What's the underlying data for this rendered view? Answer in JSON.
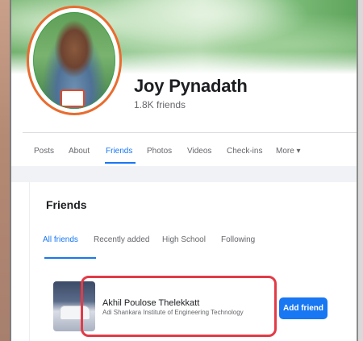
{
  "profile": {
    "name": "Joy Pynadath",
    "friends_count": "1.8K friends"
  },
  "tabs": [
    {
      "label": "Posts"
    },
    {
      "label": "About"
    },
    {
      "label": "Friends",
      "active": true
    },
    {
      "label": "Photos"
    },
    {
      "label": "Videos"
    },
    {
      "label": "Check-ins"
    },
    {
      "label": "More ▾"
    }
  ],
  "friends_section": {
    "title": "Friends",
    "subtabs": [
      {
        "label": "All friends",
        "active": true
      },
      {
        "label": "Recently added"
      },
      {
        "label": "High School"
      },
      {
        "label": "Following"
      }
    ],
    "friend": {
      "name": "Akhil Poulose Thelekkatt",
      "subtitle": "Adi Shankara Institute of Engineering Technology",
      "button_label": "Add friend"
    }
  },
  "colors": {
    "accent": "#1877f2",
    "highlight": "#e23b47",
    "avatar_ring": "#e96c2f"
  }
}
